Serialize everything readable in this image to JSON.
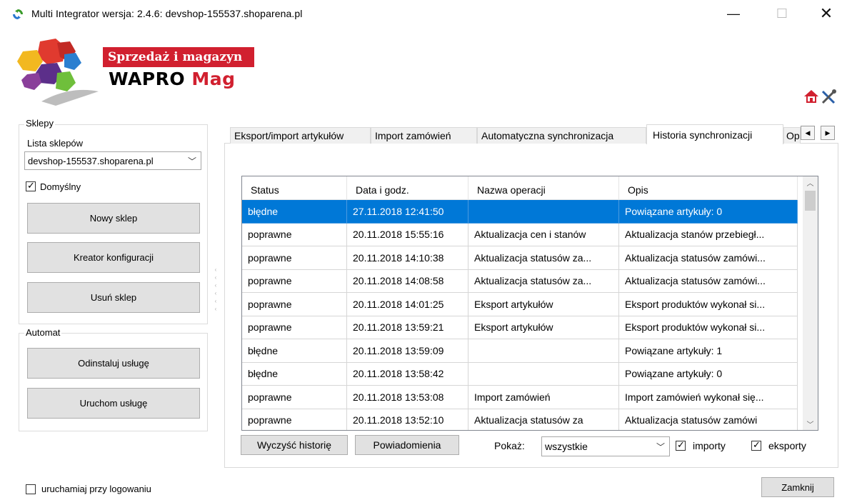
{
  "window": {
    "title": "Multi Integrator wersja: 2.4.6: devshop-155537.shoparena.pl",
    "minimize": "—",
    "maximize": "☐",
    "close": "✕"
  },
  "brand": {
    "tagline": "Sprzedaż i magazyn",
    "name_part1": "WAPRO",
    "name_part2": "Mag",
    "accent_color": "#d1202f"
  },
  "sklepy": {
    "legend": "Sklepy",
    "list_label": "Lista sklepów",
    "selected_shop": "devshop-155537.shoparena.pl",
    "default_label": "Domyślny",
    "default_checked": true,
    "new_shop_button": "Nowy sklep",
    "wizard_button": "Kreator konfiguracji",
    "delete_button": "Usuń sklep"
  },
  "automat": {
    "legend": "Automat",
    "uninstall_button": "Odinstaluj usługę",
    "start_button": "Uruchom usługę"
  },
  "tabs": [
    {
      "label": "Eksport/import artykułów",
      "active": false
    },
    {
      "label": "Import zamówień",
      "active": false
    },
    {
      "label": "Automatyczna synchronizacja",
      "active": false
    },
    {
      "label": "Historia synchronizacji",
      "active": true
    },
    {
      "label": "Op",
      "active": false
    }
  ],
  "history": {
    "columns": [
      "Status",
      "Data i godz.",
      "Nazwa operacji",
      "Opis"
    ],
    "rows": [
      [
        "błędne",
        "27.11.2018 12:41:50",
        "",
        "Powiązane artykuły: 0"
      ],
      [
        "poprawne",
        "20.11.2018 15:55:16",
        "Aktualizacja cen i stanów",
        "Aktualizacja stanów przebiegł..."
      ],
      [
        "poprawne",
        "20.11.2018 14:10:38",
        "Aktualizacja statusów za...",
        "Aktualizacja statusów zamówi..."
      ],
      [
        "poprawne",
        "20.11.2018 14:08:58",
        "Aktualizacja statusów za...",
        "Aktualizacja statusów zamówi..."
      ],
      [
        "poprawne",
        "20.11.2018 14:01:25",
        "Eksport artykułów",
        "Eksport produktów wykonał si..."
      ],
      [
        "poprawne",
        "20.11.2018 13:59:21",
        "Eksport artykułów",
        "Eksport produktów wykonał si..."
      ],
      [
        "błędne",
        "20.11.2018 13:59:09",
        "",
        "Powiązane artykuły: 1"
      ],
      [
        "błędne",
        "20.11.2018 13:58:42",
        "",
        "Powiązane artykuły: 0"
      ],
      [
        "poprawne",
        "20.11.2018 13:53:08",
        "Import zamówień",
        "Import zamówień wykonał się..."
      ],
      [
        "poprawne",
        "20.11.2018 13:52:10",
        "Aktualizacja statusów za",
        "Aktualizacja statusów zamówi"
      ]
    ],
    "selected_row": 0,
    "clear_button": "Wyczyść historię",
    "notify_button": "Powiadomienia",
    "show_label": "Pokaż:",
    "show_value": "wszystkie",
    "imports_label": "importy",
    "imports_checked": true,
    "exports_label": "eksporty",
    "exports_checked": true
  },
  "footer": {
    "autostart_label": "uruchamiaj przy logowaniu",
    "autostart_checked": false,
    "close_button": "Zamknij"
  },
  "icons": {
    "app": "refresh-arrows-icon",
    "home": "home-icon",
    "tools": "tools-icon"
  }
}
